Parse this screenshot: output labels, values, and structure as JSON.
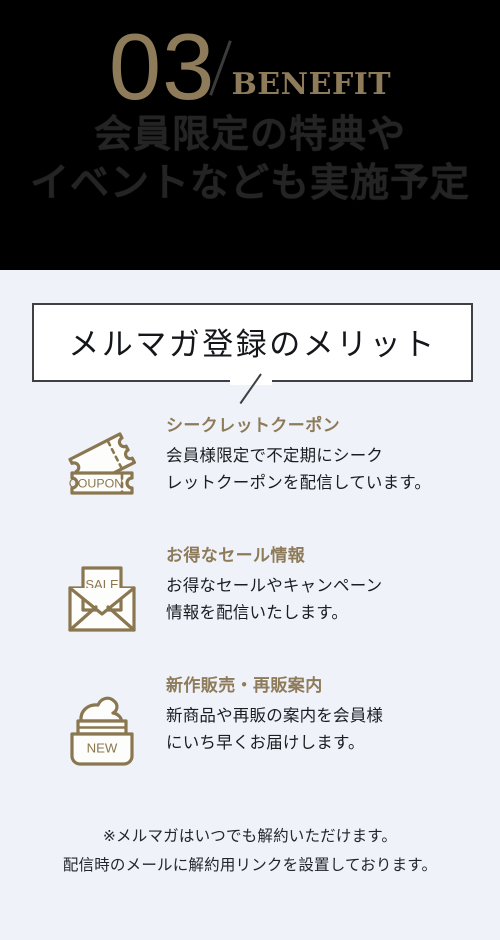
{
  "theme": {
    "hero_bg": "#000000",
    "panel_bg": "#eff2f8",
    "gold": "#8e7b5a",
    "ink": "#1b1d21",
    "border": "#3f4044",
    "card_bg": "#ffffff"
  },
  "hero": {
    "number": "03",
    "eyebrow": "BENEFIT",
    "headline_line1": "会員限定の特典や",
    "headline_line2": "イベントなども実施予定"
  },
  "panel": {
    "section_title": "メルマガ登録のメリット",
    "benefits": [
      {
        "icon": "coupon-ticket-icon",
        "icon_label": "COUPON",
        "heading": "シークレットクーポン",
        "body_line1": "会員様限定で不定期にシーク",
        "body_line2": "レットクーポンを配信しています。"
      },
      {
        "icon": "sale-envelope-icon",
        "icon_label": "SALE",
        "heading": "お得なセール情報",
        "body_line1": "お得なセールやキャンペーン",
        "body_line2": "情報を配信いたします。"
      },
      {
        "icon": "new-cream-jar-icon",
        "icon_label": "NEW",
        "heading": "新作販売・再販案内",
        "body_line1": "新商品や再販の案内を会員様",
        "body_line2": "にいち早くお届けします。"
      }
    ],
    "footnote_line1": "※メルマガはいつでも解約いただけます。",
    "footnote_line2": "配信時のメールに解約用リンクを設置しております。"
  }
}
